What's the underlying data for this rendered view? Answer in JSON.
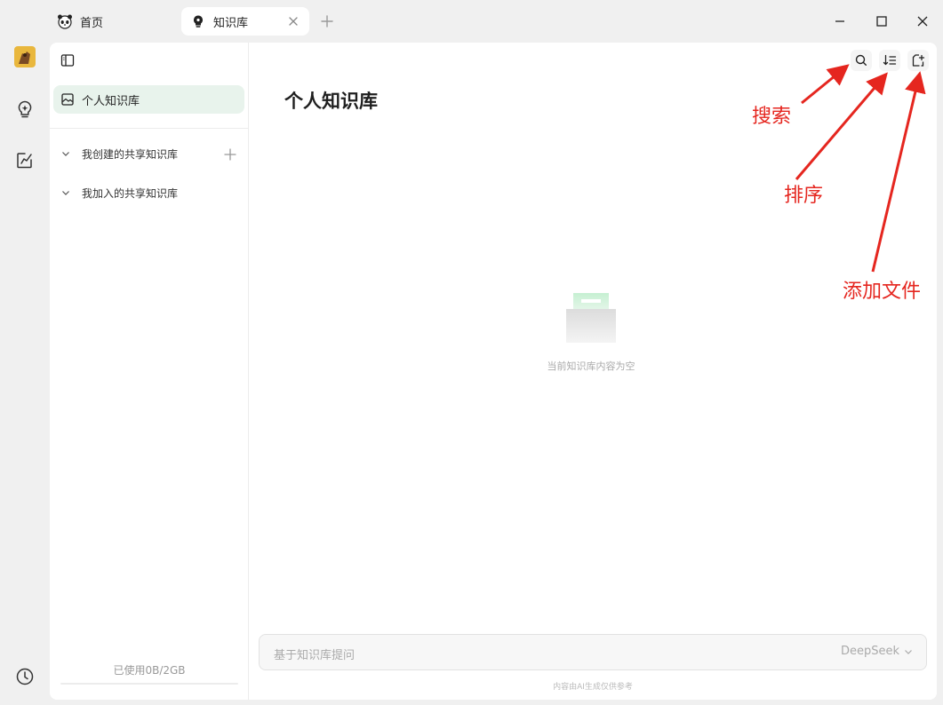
{
  "tabs": [
    {
      "label": "首页",
      "icon": "panda-icon"
    },
    {
      "label": "知识库",
      "icon": "knowledge-bulb-icon"
    }
  ],
  "sidebar": {
    "personal_label": "个人知识库",
    "groups": [
      {
        "label": "我创建的共享知识库"
      },
      {
        "label": "我加入的共享知识库"
      }
    ],
    "usage": "已使用0B/2GB"
  },
  "main": {
    "title": "个人知识库",
    "empty_text": "当前知识库内容为空",
    "ask_placeholder": "基于知识库提问",
    "model": "DeepSeek",
    "disclaimer": "内容由AI生成仅供参考"
  },
  "annotations": {
    "search": "搜索",
    "sort": "排序",
    "add_file": "添加文件"
  },
  "colors": {
    "accent_green": "#e8f3ec",
    "annotation_red": "#e5261f"
  }
}
